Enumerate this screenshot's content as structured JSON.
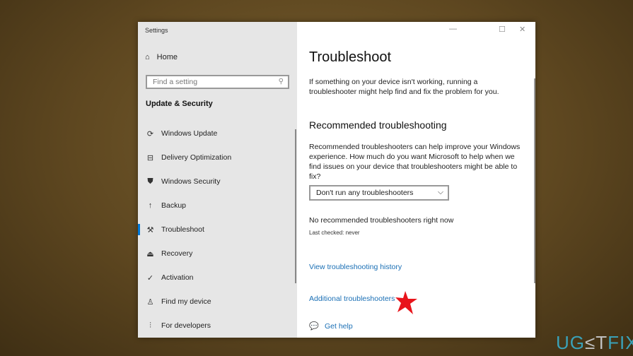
{
  "window": {
    "title": "Settings",
    "controls": [
      "minimize",
      "maximize",
      "close"
    ]
  },
  "sidebar": {
    "home": "Home",
    "search_placeholder": "Find a setting",
    "section": "Update & Security",
    "items": [
      {
        "label": "Windows Update",
        "icon": "refresh-icon"
      },
      {
        "label": "Delivery Optimization",
        "icon": "delivery-icon"
      },
      {
        "label": "Windows Security",
        "icon": "shield-icon"
      },
      {
        "label": "Backup",
        "icon": "upload-icon"
      },
      {
        "label": "Troubleshoot",
        "icon": "wrench-icon",
        "selected": true
      },
      {
        "label": "Recovery",
        "icon": "recovery-icon"
      },
      {
        "label": "Activation",
        "icon": "check-circle-icon"
      },
      {
        "label": "Find my device",
        "icon": "find-device-icon"
      },
      {
        "label": "For developers",
        "icon": "developer-icon"
      }
    ]
  },
  "main": {
    "title": "Troubleshoot",
    "intro": "If something on your device isn't working, running a troubleshooter might help find and fix the problem for you.",
    "rec_title": "Recommended troubleshooting",
    "rec_text": "Recommended troubleshooters can help improve your Windows experience. How much do you want Microsoft to help when we find issues on your device that troubleshooters might be able to fix?",
    "dropdown_value": "Don't run any troubleshooters",
    "status": "No recommended troubleshooters right now",
    "last_checked": "Last checked: never",
    "history_link": "View troubleshooting history",
    "additional_link": "Additional troubleshooters",
    "help_link": "Get help"
  },
  "watermark": {
    "text": "UGETFIX"
  },
  "colors": {
    "accent": "#0078d7",
    "link": "#1a6fb5",
    "star": "#e8141b"
  }
}
